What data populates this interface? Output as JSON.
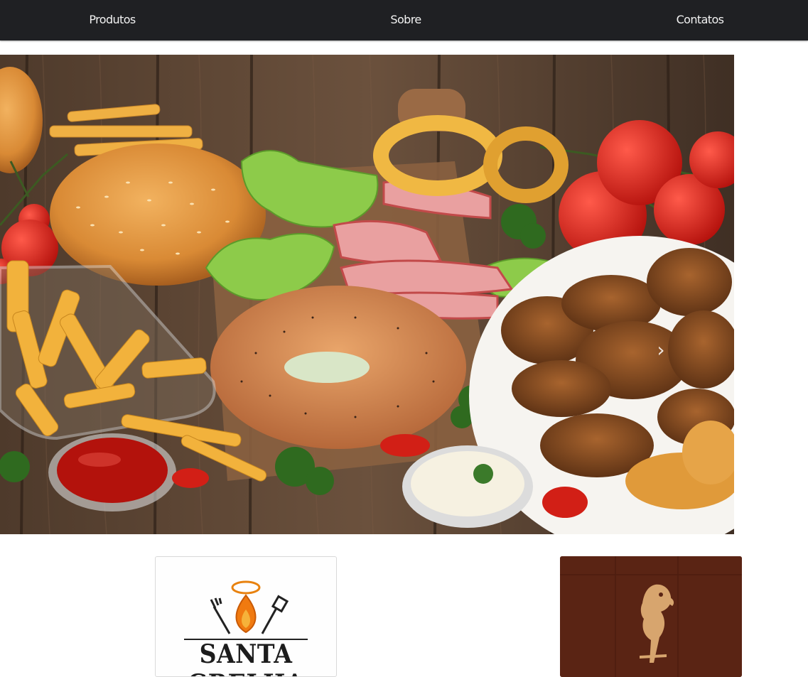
{
  "nav": {
    "links": [
      {
        "label": "Produtos"
      },
      {
        "label": "Sobre"
      },
      {
        "label": "Contatos"
      }
    ]
  },
  "hero": {
    "next_arrow": "›"
  },
  "cards": {
    "santa_grelha": {
      "brand_text": "SANTA GRELHA"
    }
  },
  "colors": {
    "navbar_bg": "#1f2023",
    "nav_text": "#f2f2f2",
    "wood": "#5e4634",
    "card2_bg": "#5a2414"
  },
  "icons": [
    "chevron-right-icon",
    "flame-icon",
    "fork-icon",
    "spatula-icon",
    "parrot-icon"
  ]
}
